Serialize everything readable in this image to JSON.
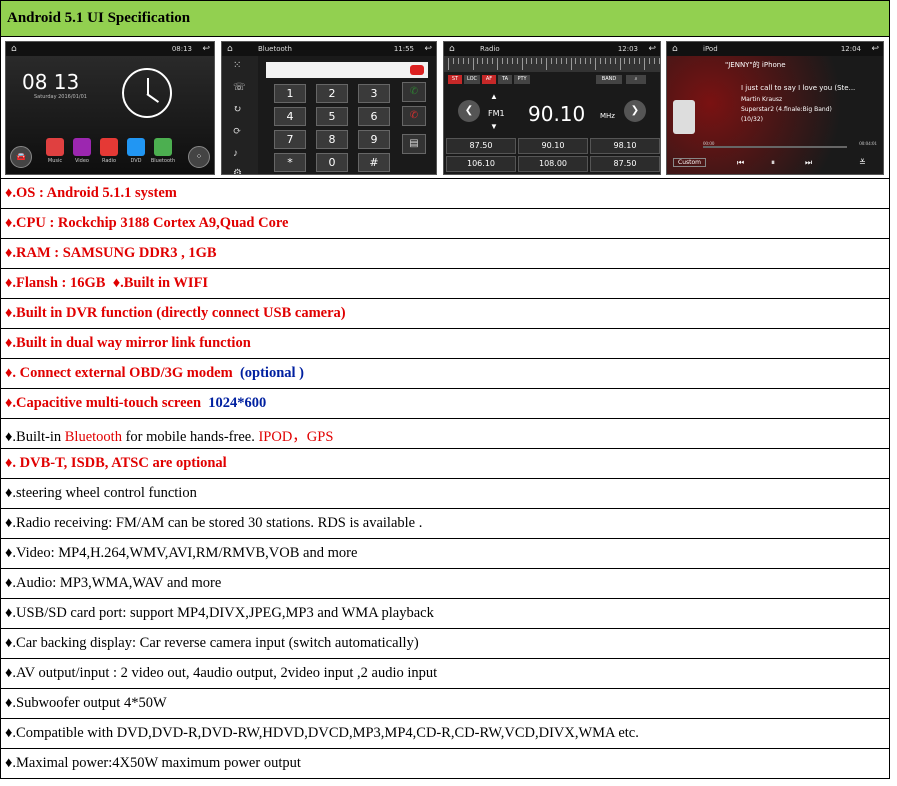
{
  "header": {
    "title": "Android 5.1 UI Specification"
  },
  "screens": {
    "home": {
      "time_status": "08:13",
      "clock": "08 13",
      "date": "Saturday 2016/01/01",
      "apps": [
        "Music",
        "Video",
        "Radio",
        "DVD",
        "Bluetooth"
      ],
      "app_colors": [
        "#e04040",
        "#9c27b0",
        "#e53935",
        "#2196f3",
        "#4caf50"
      ]
    },
    "bluetooth": {
      "title": "Bluetooth",
      "time": "11:55",
      "keys": [
        "1",
        "2",
        "3",
        "4",
        "5",
        "6",
        "7",
        "8",
        "9",
        "*",
        "0",
        "#"
      ],
      "key_subs": [
        "",
        "ABC",
        "DEF",
        "GHI",
        "JKL",
        "MNO",
        "PQRS",
        "TUV",
        "WXYZ",
        "",
        "+",
        ""
      ]
    },
    "radio": {
      "title": "Radio",
      "time": "12:03",
      "buttons": [
        "ST",
        "LOC",
        "AF",
        "TA",
        "PTY"
      ],
      "band": "BAND",
      "band_label": "FM1",
      "frequency": "90.10",
      "unit": "MHz",
      "presets": [
        "87.50",
        "90.10",
        "98.10",
        "106.10",
        "108.00",
        "87.50"
      ],
      "preset_tags": [
        "P1",
        "P2",
        "P3",
        "P4",
        "P5",
        "P6"
      ]
    },
    "ipod": {
      "title": "iPod",
      "time": "12:04",
      "device": "\"JENNY\"的 iPhone",
      "song": "I just call to say I love you (Ste...",
      "artist": "Martin Krausz",
      "album": "Superstar2 (4.finale:Big Band)",
      "track": "(10/32)",
      "elapsed": "00:00",
      "total": "00:04:01",
      "custom": "Custom"
    }
  },
  "specs": [
    {
      "segments": [
        {
          "text": "♦.OS : Android 5.1.1 system",
          "color": "red"
        }
      ]
    },
    {
      "segments": [
        {
          "text": "♦.CPU : Rockchip 3188 Cortex A9,Quad Core",
          "color": "red"
        }
      ]
    },
    {
      "segments": [
        {
          "text": "♦.RAM : SAMSUNG DDR3 , 1GB",
          "color": "red"
        }
      ]
    },
    {
      "segments": [
        {
          "text": "♦.Flansh : 16GB  ♦.Built in WIFI",
          "color": "red"
        }
      ]
    },
    {
      "segments": [
        {
          "text": "♦.Built in DVR function (directly connect USB camera)",
          "color": "red"
        }
      ]
    },
    {
      "segments": [
        {
          "text": "♦.Built in dual way mirror link function",
          "color": "red"
        }
      ]
    },
    {
      "segments": [
        {
          "text": "♦. Connect external OBD/3G modem  ",
          "color": "red"
        },
        {
          "text": "(optional )",
          "color": "blue"
        }
      ]
    },
    {
      "segments": [
        {
          "text": "♦.Capacitive multi-touch screen  ",
          "color": "red"
        },
        {
          "text": "1024*600",
          "color": "blue"
        }
      ]
    },
    {
      "segments": [
        {
          "text": "♦.Built-in ",
          "color": "black"
        },
        {
          "text": "Bluetooth",
          "color": "red-normal"
        },
        {
          "text": " for mobile hands-free. ",
          "color": "black"
        },
        {
          "text": "IPOD，GPS",
          "color": "red-normal"
        }
      ]
    },
    {
      "segments": [
        {
          "text": "♦. DVB-T, ISDB, ATSC are optional",
          "color": "red"
        }
      ]
    },
    {
      "segments": [
        {
          "text": "♦.steering wheel control function",
          "color": "black"
        }
      ]
    },
    {
      "segments": [
        {
          "text": "♦.Radio receiving: FM/AM can be stored 30 stations. RDS is available .",
          "color": "black"
        }
      ]
    },
    {
      "segments": [
        {
          "text": "♦.Video: MP4,H.264,WMV,AVI,RM/RMVB,VOB and more",
          "color": "black"
        }
      ]
    },
    {
      "segments": [
        {
          "text": "♦.Audio: MP3,WMA,WAV and more",
          "color": "black"
        }
      ]
    },
    {
      "segments": [
        {
          "text": "♦.USB/SD card port: support MP4,DIVX,JPEG,MP3 and WMA playback",
          "color": "black"
        }
      ]
    },
    {
      "segments": [
        {
          "text": "♦.Car backing display: Car reverse camera input (switch automatically)",
          "color": "black"
        }
      ]
    },
    {
      "segments": [
        {
          "text": "♦.AV output/input : 2 video out, 4audio output, 2video input ,2 audio input",
          "color": "black"
        }
      ]
    },
    {
      "segments": [
        {
          "text": "♦.Subwoofer output 4*50W",
          "color": "black"
        }
      ]
    },
    {
      "segments": [
        {
          "text": "♦.Compatible with DVD,DVD-R,DVD-RW,HDVD,DVCD,MP3,MP4,CD-R,CD-RW,VCD,DIVX,WMA etc.",
          "color": "black"
        }
      ]
    },
    {
      "segments": [
        {
          "text": "♦.Maximal power:4X50W maximum power output",
          "color": "black"
        }
      ]
    }
  ]
}
